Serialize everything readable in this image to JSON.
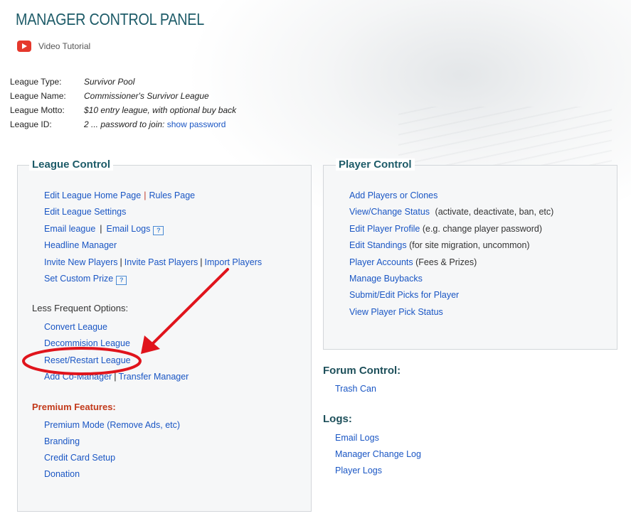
{
  "page": {
    "title": "MANAGER CONTROL PANEL",
    "video_tutorial": "Video Tutorial"
  },
  "league_info": {
    "rows": [
      {
        "key": "League Type:",
        "value": "Survivor Pool"
      },
      {
        "key": "League Name:",
        "value": "Commissioner's Survivor League"
      },
      {
        "key": "League Motto:",
        "value": "$10 entry league, with optional buy back"
      },
      {
        "key": "League ID:",
        "value": "2 ... password to join:",
        "link": "show password"
      }
    ]
  },
  "league_control": {
    "title": "League Control",
    "edit_home": "Edit League Home Page",
    "rules_page": "Rules Page",
    "edit_settings": "Edit League Settings",
    "email_league": "Email league",
    "email_logs": "Email Logs",
    "headline_manager": "Headline Manager",
    "invite_new": "Invite New Players",
    "invite_past": "Invite Past Players",
    "import_players": "Import Players",
    "set_custom_prize": "Set Custom Prize",
    "less_frequent": "Less Frequent Options:",
    "convert_league": "Convert League",
    "decommission_league": "Decommision League",
    "reset_restart": "Reset/Restart League",
    "add_comanager": "Add Co-Manager",
    "transfer_manager": "Transfer Manager",
    "premium_features": "Premium Features:",
    "premium_mode": "Premium Mode (Remove Ads, etc)",
    "branding": "Branding",
    "credit_card": "Credit Card Setup",
    "donation": "Donation",
    "help_glyph": "?"
  },
  "player_control": {
    "title": "Player Control",
    "items": [
      {
        "link": "Add Players or Clones",
        "note": ""
      },
      {
        "link": "View/Change Status",
        "note": "(activate, deactivate, ban, etc)"
      },
      {
        "link": "Edit Player Profile",
        "note": "(e.g. change player password)"
      },
      {
        "link": "Edit Standings",
        "note": "(for site migration, uncommon)"
      },
      {
        "link": "Player Accounts",
        "note": "(Fees & Prizes)"
      },
      {
        "link": "Manage Buybacks",
        "note": ""
      },
      {
        "link": "Submit/Edit Picks for Player",
        "note": ""
      },
      {
        "link": "View Player Pick Status",
        "note": ""
      }
    ]
  },
  "forum_control": {
    "title": "Forum Control:",
    "trash_can": "Trash Can"
  },
  "logs": {
    "title": "Logs:",
    "email_logs": "Email Logs",
    "manager_change_log": "Manager Change Log",
    "player_logs": "Player Logs"
  },
  "colors": {
    "heading": "#1d5b68",
    "link": "#1a56c4",
    "annotation": "#e0141c",
    "premium": "#c23a1b"
  }
}
